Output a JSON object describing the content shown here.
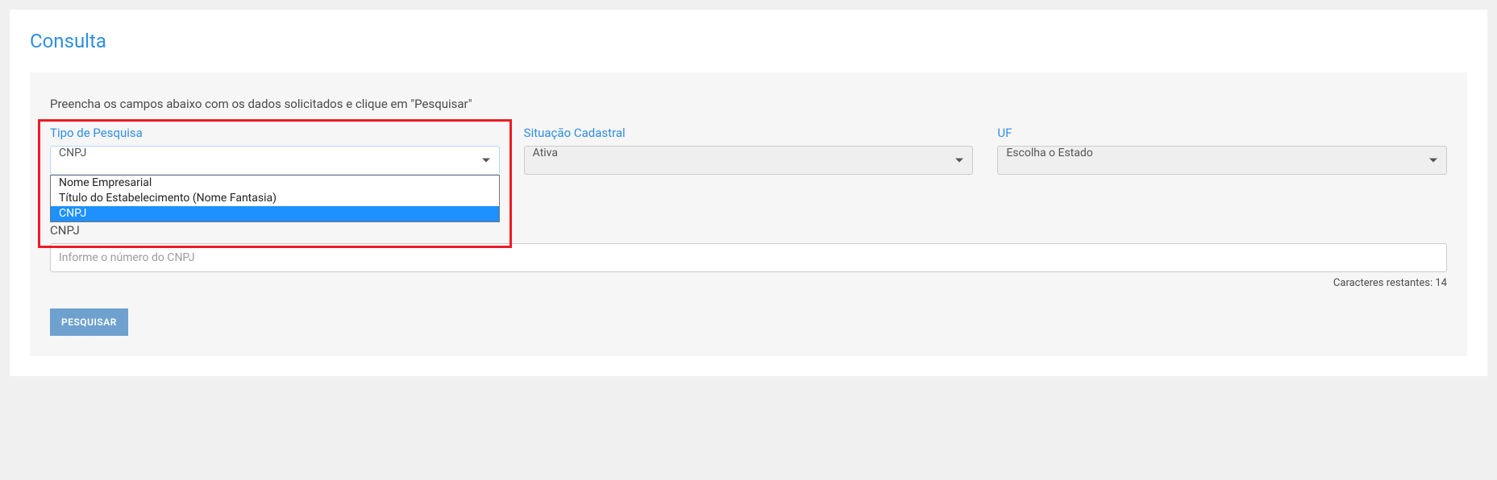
{
  "page_title": "Consulta",
  "instruction": "Preencha os campos abaixo com os dados solicitados e clique em \"Pesquisar\"",
  "tipo_pesquisa": {
    "label": "Tipo de Pesquisa",
    "selected": "CNPJ",
    "options": [
      "Nome Empresarial",
      "Título do Estabelecimento (Nome Fantasia)",
      "CNPJ"
    ]
  },
  "situacao": {
    "label": "Situação Cadastral",
    "selected": "Ativa"
  },
  "uf": {
    "label": "UF",
    "selected": "Escolha o Estado"
  },
  "cnpj_field": {
    "label": "CNPJ",
    "placeholder": "Informe o número do CNPJ",
    "char_counter_prefix": "Caracteres restantes: ",
    "char_counter_value": "14"
  },
  "search_button": "PESQUISAR"
}
